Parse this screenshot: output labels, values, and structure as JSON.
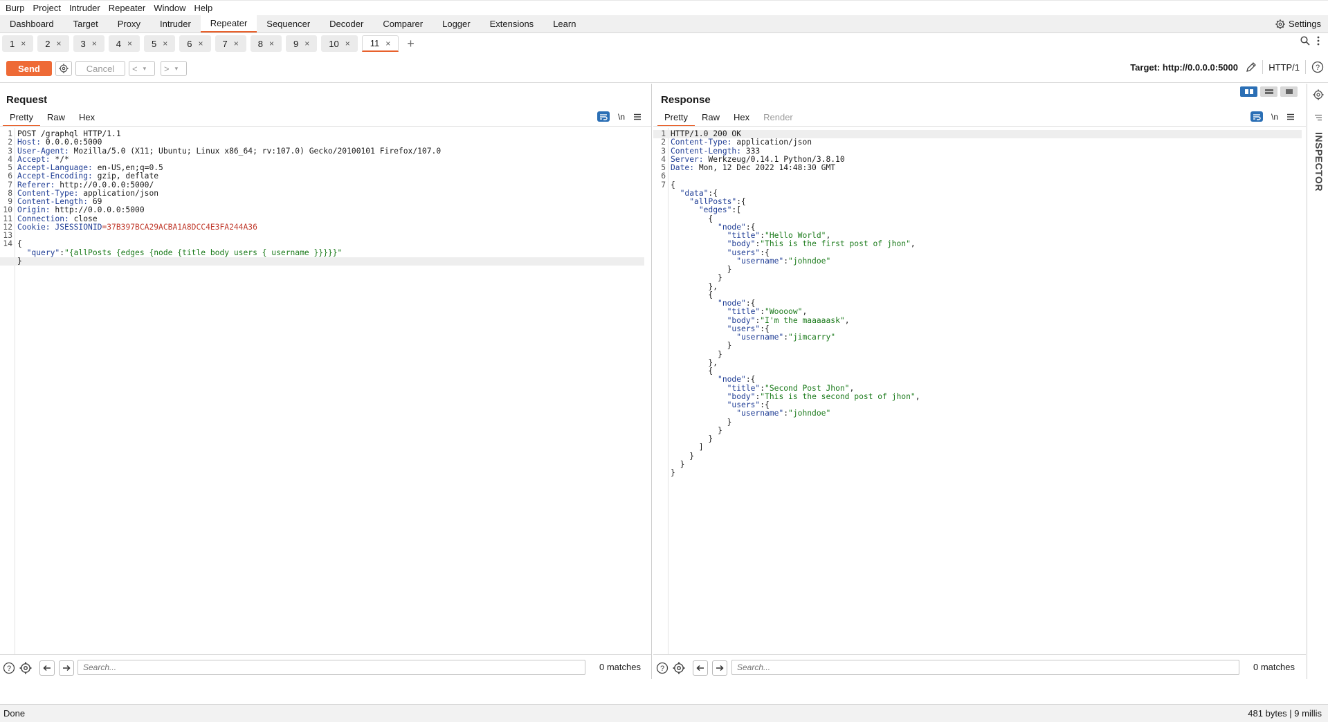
{
  "menubar": [
    "Burp",
    "Project",
    "Intruder",
    "Repeater",
    "Window",
    "Help"
  ],
  "modules": [
    "Dashboard",
    "Target",
    "Proxy",
    "Intruder",
    "Repeater",
    "Sequencer",
    "Decoder",
    "Comparer",
    "Logger",
    "Extensions",
    "Learn"
  ],
  "active_module": "Repeater",
  "settings_label": "Settings",
  "repeater_tabs": [
    "1",
    "2",
    "3",
    "4",
    "5",
    "6",
    "7",
    "8",
    "9",
    "10",
    "11"
  ],
  "active_repeater_tab": "11",
  "toolbar": {
    "send_label": "Send",
    "cancel_label": "Cancel",
    "target_label": "Target: http://0.0.0.0:5000",
    "http_version": "HTTP/1"
  },
  "request": {
    "title": "Request",
    "tabs": [
      "Pretty",
      "Raw",
      "Hex"
    ],
    "active_tab": "Pretty",
    "newline_label": "\\n",
    "lines": [
      {
        "n": "1",
        "h": "",
        "v": "POST /graphql HTTP/1.1"
      },
      {
        "n": "2",
        "h": "Host:",
        "v": " 0.0.0.0:5000"
      },
      {
        "n": "3",
        "h": "User-Agent:",
        "v": " Mozilla/5.0 (X11; Ubuntu; Linux x86_64; rv:107.0) Gecko/20100101 Firefox/107.0"
      },
      {
        "n": "4",
        "h": "Accept:",
        "v": " */*"
      },
      {
        "n": "5",
        "h": "Accept-Language:",
        "v": " en-US,en;q=0.5"
      },
      {
        "n": "6",
        "h": "Accept-Encoding:",
        "v": " gzip, deflate"
      },
      {
        "n": "7",
        "h": "Referer:",
        "v": " http://0.0.0.0:5000/"
      },
      {
        "n": "8",
        "h": "Content-Type:",
        "v": " application/json"
      },
      {
        "n": "9",
        "h": "Content-Length:",
        "v": " 69"
      },
      {
        "n": "10",
        "h": "Origin:",
        "v": " http://0.0.0.0:5000"
      },
      {
        "n": "11",
        "h": "Connection:",
        "v": " close"
      },
      {
        "n": "12",
        "h": "Cookie:",
        "v": " ",
        "ck": "JSESSIONID",
        "cv": "=37B397BCA29ACBA1A8DCC4E3FA244A36"
      },
      {
        "n": "13",
        "h": "",
        "v": ""
      },
      {
        "n": "14",
        "h": "",
        "v": "{"
      },
      {
        "n": "",
        "indent": "  ",
        "k": "\"query\"",
        "sep": ":",
        "s": "\"{allPosts {edges {node {title body users { username }}}}}\""
      },
      {
        "n": "",
        "h": "",
        "v": "}",
        "hl": true
      }
    ],
    "search_placeholder": "Search...",
    "matches": "0 matches"
  },
  "response": {
    "title": "Response",
    "tabs": [
      "Pretty",
      "Raw",
      "Hex",
      "Render"
    ],
    "active_tab": "Pretty",
    "newline_label": "\\n",
    "lines": [
      {
        "n": "1",
        "h": "",
        "v": "HTTP/1.0 200 OK",
        "hl": true
      },
      {
        "n": "2",
        "h": "Content-Type:",
        "v": " application/json"
      },
      {
        "n": "3",
        "h": "Content-Length:",
        "v": " 333"
      },
      {
        "n": "4",
        "h": "Server:",
        "v": " Werkzeug/0.14.1 Python/3.8.10"
      },
      {
        "n": "5",
        "h": "Date:",
        "v": " Mon, 12 Dec 2022 14:48:30 GMT"
      },
      {
        "n": "6",
        "h": "",
        "v": ""
      },
      {
        "n": "7",
        "h": "",
        "v": "{"
      },
      {
        "n": "",
        "indent": "  ",
        "k": "\"data\"",
        "sep": ":{",
        "s": ""
      },
      {
        "n": "",
        "indent": "    ",
        "k": "\"allPosts\"",
        "sep": ":{",
        "s": ""
      },
      {
        "n": "",
        "indent": "      ",
        "k": "\"edges\"",
        "sep": ":[",
        "s": ""
      },
      {
        "n": "",
        "h": "",
        "v": "        {"
      },
      {
        "n": "",
        "indent": "          ",
        "k": "\"node\"",
        "sep": ":{",
        "s": ""
      },
      {
        "n": "",
        "indent": "            ",
        "k": "\"title\"",
        "sep": ":",
        "s": "\"Hello World\"",
        "tail": ","
      },
      {
        "n": "",
        "indent": "            ",
        "k": "\"body\"",
        "sep": ":",
        "s": "\"This is the first post of jhon\"",
        "tail": ","
      },
      {
        "n": "",
        "indent": "            ",
        "k": "\"users\"",
        "sep": ":{",
        "s": ""
      },
      {
        "n": "",
        "indent": "              ",
        "k": "\"username\"",
        "sep": ":",
        "s": "\"johndoe\""
      },
      {
        "n": "",
        "h": "",
        "v": "            }"
      },
      {
        "n": "",
        "h": "",
        "v": "          }"
      },
      {
        "n": "",
        "h": "",
        "v": "        },"
      },
      {
        "n": "",
        "h": "",
        "v": "        {"
      },
      {
        "n": "",
        "indent": "          ",
        "k": "\"node\"",
        "sep": ":{",
        "s": ""
      },
      {
        "n": "",
        "indent": "            ",
        "k": "\"title\"",
        "sep": ":",
        "s": "\"Woooow\"",
        "tail": ","
      },
      {
        "n": "",
        "indent": "            ",
        "k": "\"body\"",
        "sep": ":",
        "s": "\"I'm the maaaaask\"",
        "tail": ","
      },
      {
        "n": "",
        "indent": "            ",
        "k": "\"users\"",
        "sep": ":{",
        "s": ""
      },
      {
        "n": "",
        "indent": "              ",
        "k": "\"username\"",
        "sep": ":",
        "s": "\"jimcarry\""
      },
      {
        "n": "",
        "h": "",
        "v": "            }"
      },
      {
        "n": "",
        "h": "",
        "v": "          }"
      },
      {
        "n": "",
        "h": "",
        "v": "        },"
      },
      {
        "n": "",
        "h": "",
        "v": "        {"
      },
      {
        "n": "",
        "indent": "          ",
        "k": "\"node\"",
        "sep": ":{",
        "s": ""
      },
      {
        "n": "",
        "indent": "            ",
        "k": "\"title\"",
        "sep": ":",
        "s": "\"Second Post Jhon\"",
        "tail": ","
      },
      {
        "n": "",
        "indent": "            ",
        "k": "\"body\"",
        "sep": ":",
        "s": "\"This is the second post of jhon\"",
        "tail": ","
      },
      {
        "n": "",
        "indent": "            ",
        "k": "\"users\"",
        "sep": ":{",
        "s": ""
      },
      {
        "n": "",
        "indent": "              ",
        "k": "\"username\"",
        "sep": ":",
        "s": "\"johndoe\""
      },
      {
        "n": "",
        "h": "",
        "v": "            }"
      },
      {
        "n": "",
        "h": "",
        "v": "          }"
      },
      {
        "n": "",
        "h": "",
        "v": "        }"
      },
      {
        "n": "",
        "h": "",
        "v": "      ]"
      },
      {
        "n": "",
        "h": "",
        "v": "    }"
      },
      {
        "n": "",
        "h": "",
        "v": "  }"
      },
      {
        "n": "",
        "h": "",
        "v": "}"
      }
    ],
    "search_placeholder": "Search...",
    "matches": "0 matches"
  },
  "inspector_label": "INSPECTOR",
  "status": {
    "left": "Done",
    "right": "481 bytes | 9 millis"
  },
  "colors": {
    "accent": "#e8612c",
    "send_button": "#ee6a36",
    "header_name": "#1f3d95",
    "json_string": "#1a7a1a",
    "cookie_value": "#c0392b",
    "active_toggle": "#2b6fb5"
  },
  "icons": [
    "settings-gear-icon",
    "close-icon",
    "plus-icon",
    "search-icon",
    "kebab-menu-icon",
    "edit-pencil-icon",
    "help-icon",
    "wrap-lines-icon",
    "hamburger-menu-icon",
    "arrow-left-icon",
    "arrow-right-icon",
    "layout-split-icon"
  ]
}
